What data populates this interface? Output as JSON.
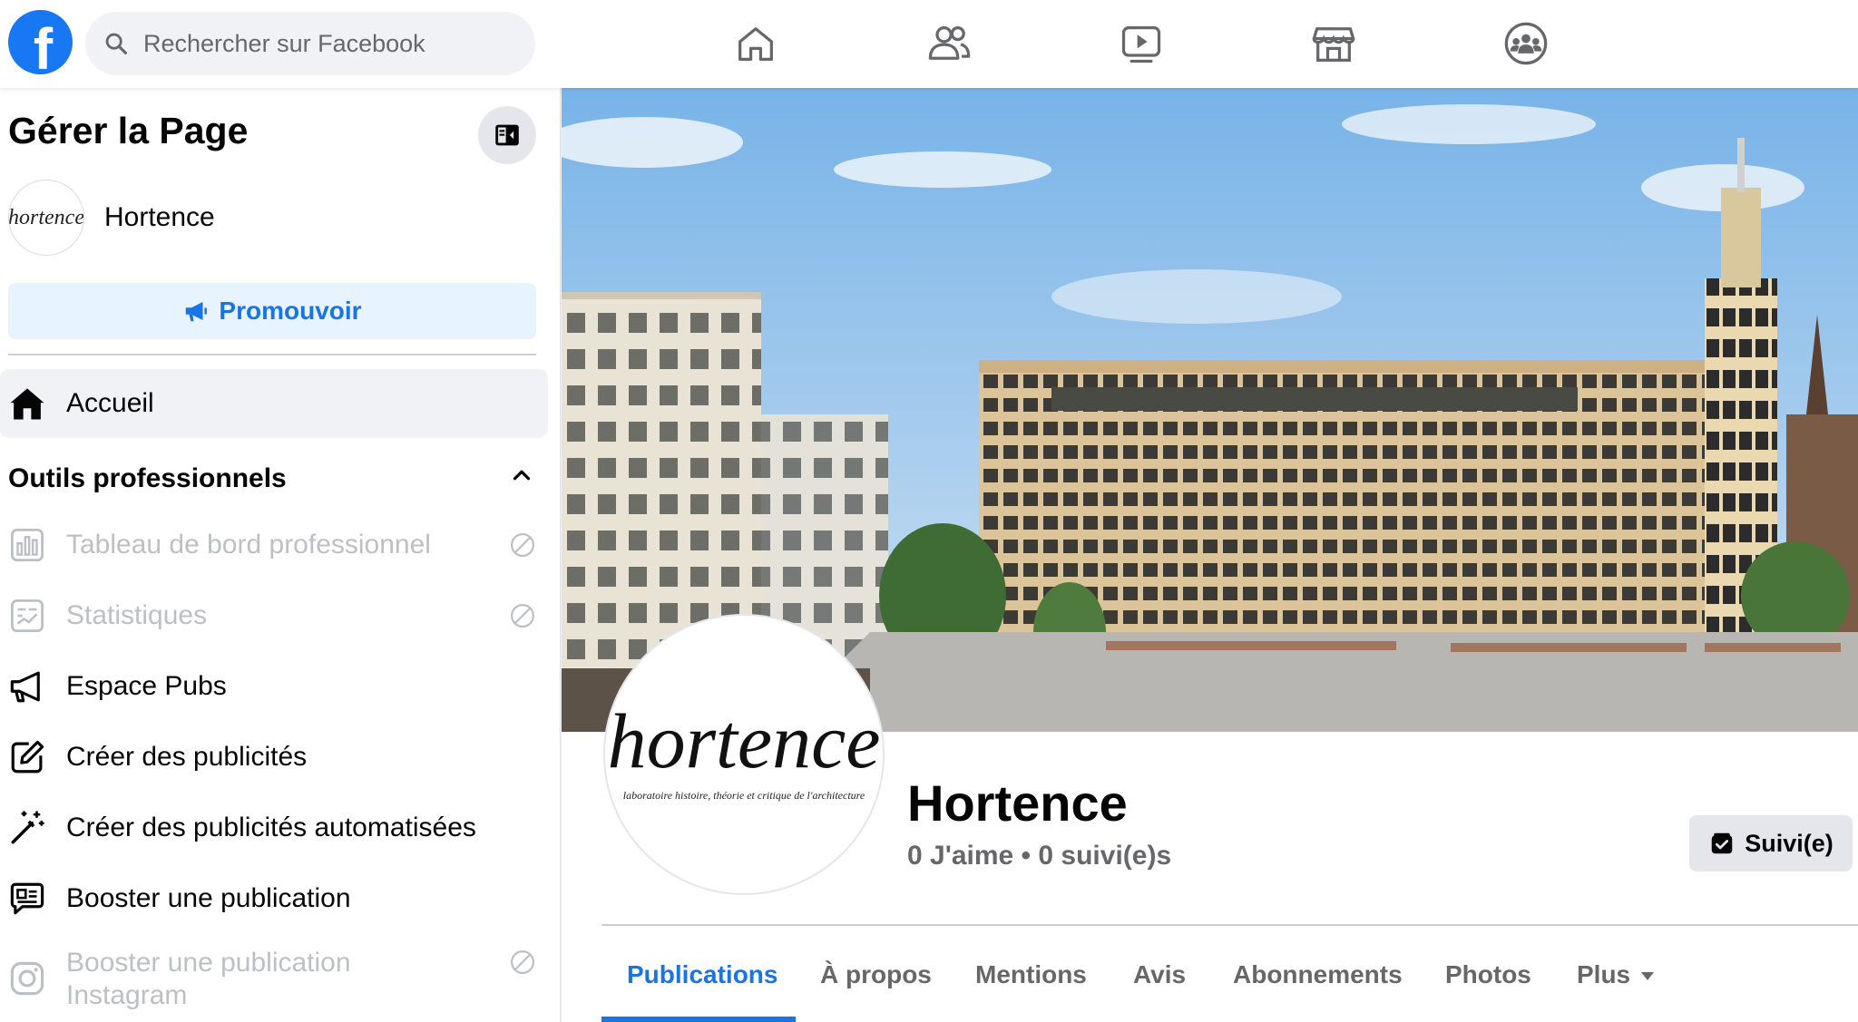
{
  "header": {
    "search_placeholder": "Rechercher sur Facebook",
    "nav": [
      "home-icon",
      "friends-icon",
      "watch-icon",
      "marketplace-icon",
      "groups-icon"
    ]
  },
  "sidebar": {
    "title": "Gérer la Page",
    "page_avatar_text": "hortence",
    "page_name": "Hortence",
    "promote_label": "Promouvoir",
    "home_label": "Accueil",
    "section_title": "Outils professionnels",
    "tools": [
      {
        "label": "Tableau de bord professionnel",
        "disabled": true
      },
      {
        "label": "Statistiques",
        "disabled": true
      },
      {
        "label": "Espace Pubs",
        "disabled": false
      },
      {
        "label": "Créer des publicités",
        "disabled": false
      },
      {
        "label": "Créer des publicités automatisées",
        "disabled": false
      },
      {
        "label": "Booster une publication",
        "disabled": false
      },
      {
        "label": "Booster une publication Instagram",
        "disabled": true
      }
    ]
  },
  "main": {
    "profile_logo_word": "hortence",
    "profile_logo_sub": "laboratoire histoire, théorie et critique de l'architecture",
    "page_name": "Hortence",
    "stats": "0 J'aime • 0 suivi(e)s",
    "follow_label": "Suivi(e)",
    "tabs": [
      {
        "label": "Publications",
        "active": true
      },
      {
        "label": "À propos",
        "active": false
      },
      {
        "label": "Mentions",
        "active": false
      },
      {
        "label": "Avis",
        "active": false
      },
      {
        "label": "Abonnements",
        "active": false
      },
      {
        "label": "Photos",
        "active": false
      },
      {
        "label": "Plus",
        "active": false
      }
    ]
  },
  "colors": {
    "brand": "#1877f2",
    "link_blue": "#1b74e4",
    "promote_bg": "#e7f3ff",
    "muted_text": "#65676b",
    "disabled_text": "#bcc0c4"
  }
}
